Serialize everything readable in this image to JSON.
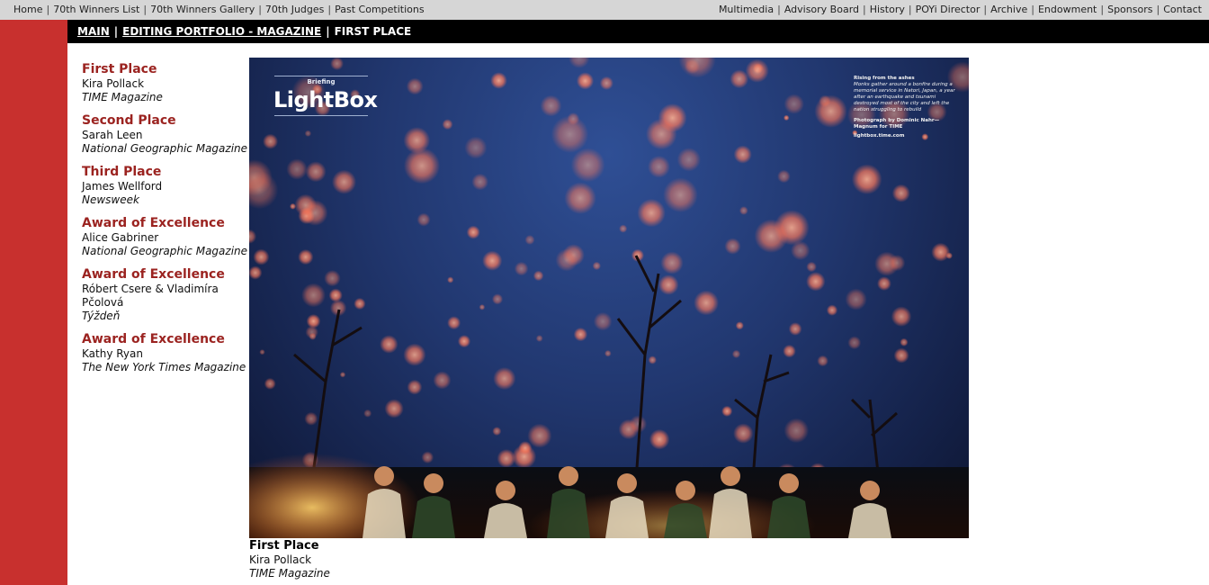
{
  "topnav": {
    "left": [
      {
        "label": "Home"
      },
      {
        "label": "70th Winners List"
      },
      {
        "label": "70th Winners Gallery"
      },
      {
        "label": "70th Judges"
      },
      {
        "label": "Past Competitions"
      }
    ],
    "right": [
      {
        "label": "Multimedia"
      },
      {
        "label": "Advisory Board"
      },
      {
        "label": "History"
      },
      {
        "label": "POYi Director"
      },
      {
        "label": "Archive"
      },
      {
        "label": "Endowment"
      },
      {
        "label": "Sponsors"
      },
      {
        "label": "Contact"
      }
    ]
  },
  "breadcrumb": {
    "main": "MAIN",
    "category": "EDITING PORTFOLIO - MAGAZINE",
    "current": "FIRST PLACE"
  },
  "awards": [
    {
      "place": "First Place",
      "person": "Kira Pollack",
      "pub": "TIME Magazine"
    },
    {
      "place": "Second Place",
      "person": "Sarah Leen",
      "pub": "National Geographic Magazine"
    },
    {
      "place": "Third Place",
      "person": "James Wellford",
      "pub": "Newsweek"
    },
    {
      "place": "Award of Excellence",
      "person": "Alice Gabriner",
      "pub": "National Geographic Magazine"
    },
    {
      "place": "Award of Excellence",
      "person": "Róbert Csere & Vladimíra Pčolová",
      "pub": "Týždeň"
    },
    {
      "place": "Award of Excellence",
      "person": "Kathy Ryan",
      "pub": "The New York Times Magazine"
    }
  ],
  "photo": {
    "briefing": "Briefing",
    "logo": "LightBox",
    "caption_title": "Rising from the ashes",
    "caption_body": "Monks gather around a bonfire during a memorial service in Natori, Japan, a year after an earthquake and tsunami destroyed most of the city and left the nation struggling to rebuild",
    "credit": "Photograph by Dominic Nahr—Magnum for TIME",
    "url": "lightbox.time.com"
  },
  "caption": {
    "place": "First Place",
    "person": "Kira Pollack",
    "pub": "TIME Magazine"
  },
  "colors": {
    "red_bar": "#c8302e",
    "award_title": "#9b2320",
    "top_nav_bg": "#d6d6d6",
    "breadcrumb_bg": "#000000"
  }
}
